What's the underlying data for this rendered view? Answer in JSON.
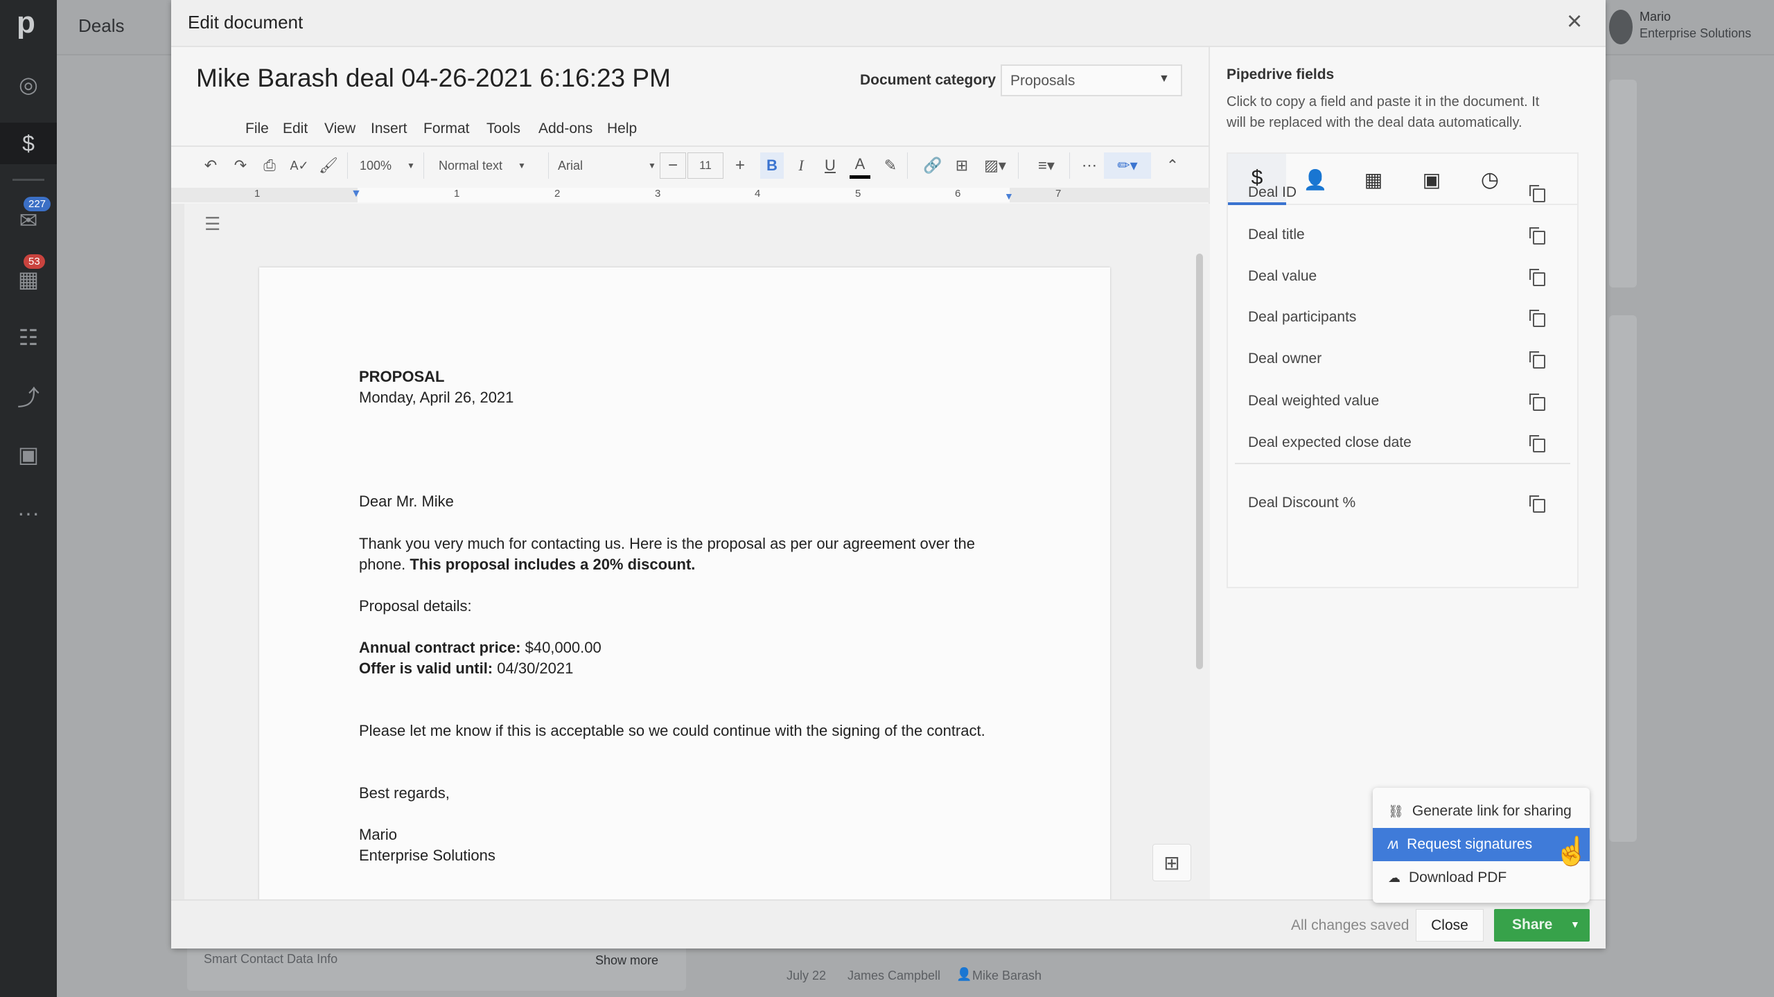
{
  "sidebar": {
    "logo": "p",
    "items": [
      {
        "icon": "target-icon"
      },
      {
        "icon": "dollar-icon",
        "active": true
      },
      {
        "icon": "mail-icon",
        "badge": "227",
        "badge_color": "#3b6fc5"
      },
      {
        "icon": "calendar-icon",
        "badge": "53",
        "badge_color": "#c9433e"
      },
      {
        "icon": "contacts-icon"
      },
      {
        "icon": "chart-icon"
      },
      {
        "icon": "products-icon"
      },
      {
        "icon": "more-icon"
      }
    ]
  },
  "topbar": {
    "title": "Deals",
    "user_name": "Mario",
    "user_company": "Enterprise Solutions"
  },
  "background": {
    "smart_contact": "Smart Contact Data Info",
    "show_more": "Show more",
    "activity_date": "July 22",
    "activity_user": "James Campbell",
    "activity_person": "Mike Barash"
  },
  "modal": {
    "title": "Edit document",
    "close_icon": "×"
  },
  "doc": {
    "title": "Mike Barash deal 04-26-2021 6:16:23 PM",
    "category_label": "Document category",
    "category_value": "Proposals",
    "menu": [
      "File",
      "Edit",
      "View",
      "Insert",
      "Format",
      "Tools",
      "Add-ons",
      "Help"
    ],
    "toolbar": {
      "zoom": "100%",
      "style": "Normal text",
      "font": "Arial",
      "size": "11",
      "bold": "B",
      "italic": "I",
      "underline": "U",
      "color": "A"
    },
    "ruler": [
      "1",
      "1",
      "2",
      "3",
      "4",
      "5",
      "6",
      "7"
    ],
    "body": {
      "heading": "PROPOSAL",
      "date": "Monday, April 26, 2021",
      "greeting": "Dear Mr. Mike",
      "p1a": "Thank you very much for contacting us. Here is the proposal as per our agreement over the",
      "p1b": "phone. ",
      "p1c": "This proposal includes a 20% discount.",
      "details": "Proposal details:",
      "price_label": "Annual contract price:",
      "price_value": " $40,000.00",
      "valid_label": "Offer is valid until:",
      "valid_value": " 04/30/2021",
      "p2": "Please let me know if this is acceptable so we could continue with the signing of the contract.",
      "regards": "Best regards,",
      "sign_name": "Mario",
      "sign_company": "Enterprise Solutions"
    }
  },
  "fields_panel": {
    "title": "Pipedrive fields",
    "description_1": "Click to copy a field and paste it in the document. It",
    "description_2": "will be replaced with the deal data automatically.",
    "tabs": [
      {
        "icon": "deal-icon",
        "active": true
      },
      {
        "icon": "person-icon"
      },
      {
        "icon": "organization-icon"
      },
      {
        "icon": "product-icon"
      },
      {
        "icon": "clock-icon"
      }
    ],
    "fields": [
      "Deal ID",
      "Deal title",
      "Deal value",
      "Deal participants",
      "Deal owner",
      "Deal weighted value",
      "Deal expected close date"
    ],
    "custom_fields": [
      "Deal Discount %"
    ]
  },
  "footer": {
    "status": "All changes saved",
    "close": "Close",
    "share": "Share",
    "share_color": "#37a24a"
  },
  "share_menu": {
    "items": [
      {
        "label": "Generate link for sharing",
        "icon": "link-icon"
      },
      {
        "label": "Request signatures",
        "icon": "signature-icon",
        "highlighted": true
      },
      {
        "label": "Download PDF",
        "icon": "cloud-download-icon"
      }
    ],
    "highlight_color": "#3f7bd9"
  }
}
